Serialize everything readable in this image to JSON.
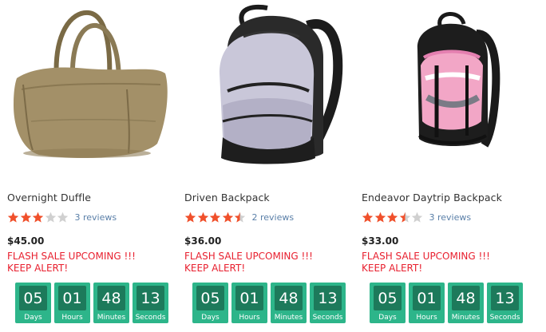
{
  "products": [
    {
      "image_icon": "duffle-bag-image",
      "name": "Overnight Duffle",
      "rating": 3,
      "reviews": "3 reviews",
      "price": "$45.00",
      "flash_line1": "FLASH SALE UPCOMING !!!",
      "flash_line2": "KEEP ALERT!",
      "countdown": [
        {
          "value": "05",
          "label": "Days"
        },
        {
          "value": "01",
          "label": "Hours"
        },
        {
          "value": "48",
          "label": "Minutes"
        },
        {
          "value": "13",
          "label": "Seconds"
        }
      ]
    },
    {
      "image_icon": "backpack-grey-image",
      "name": "Driven Backpack",
      "rating": 4.5,
      "reviews": "2 reviews",
      "price": "$36.00",
      "flash_line1": "FLASH SALE UPCOMING !!!",
      "flash_line2": "KEEP ALERT!",
      "countdown": [
        {
          "value": "05",
          "label": "Days"
        },
        {
          "value": "01",
          "label": "Hours"
        },
        {
          "value": "48",
          "label": "Minutes"
        },
        {
          "value": "13",
          "label": "Seconds"
        }
      ]
    },
    {
      "image_icon": "backpack-pink-image",
      "name": "Endeavor Daytrip Backpack",
      "rating": 3.5,
      "reviews": "3 reviews",
      "price": "$33.00",
      "flash_line1": "FLASH SALE UPCOMING !!!",
      "flash_line2": "KEEP ALERT!",
      "countdown": [
        {
          "value": "05",
          "label": "Days"
        },
        {
          "value": "01",
          "label": "Hours"
        },
        {
          "value": "48",
          "label": "Minutes"
        },
        {
          "value": "13",
          "label": "Seconds"
        }
      ]
    }
  ],
  "colors": {
    "star_filled": "#f0502b",
    "star_empty": "#d0d0d0",
    "flash": "#e8202f",
    "countdown_bg": "#2db58a",
    "countdown_num_bg": "#1d7a5b",
    "review_link": "#5a7fa8"
  }
}
